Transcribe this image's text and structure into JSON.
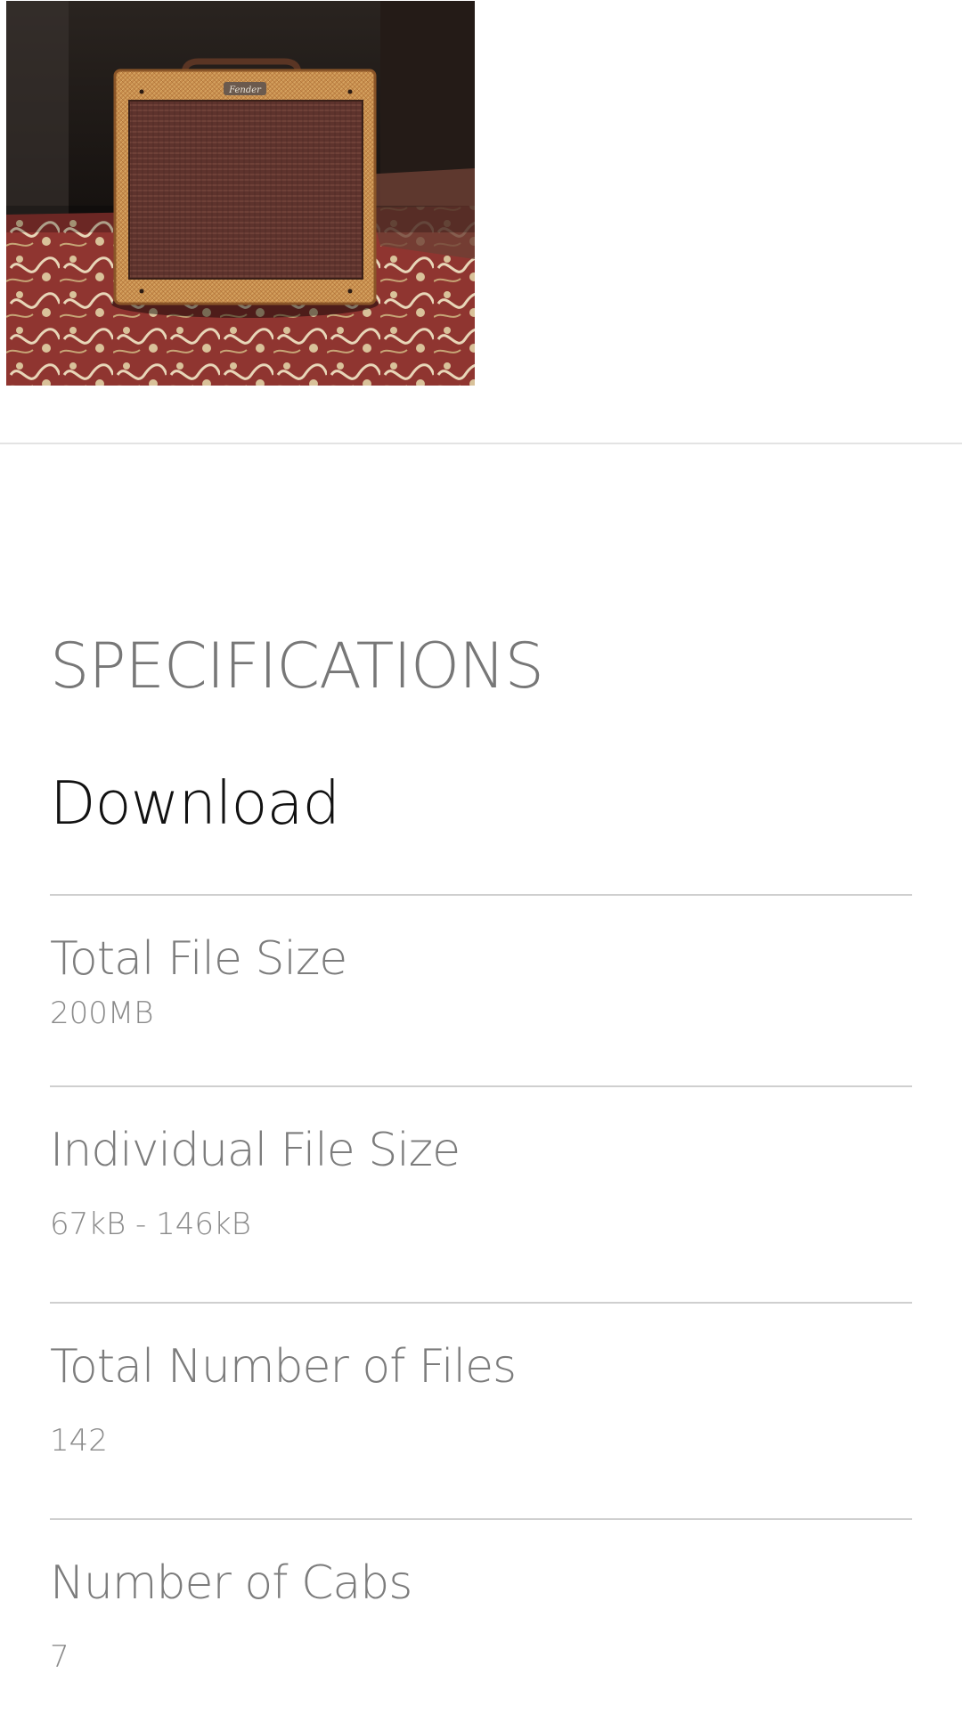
{
  "product_image": {
    "alt": "Tweed guitar amplifier on a patterned rug",
    "badge_text": "Fender",
    "colors": {
      "background": "#1c1613",
      "tweed": "#c98f4e",
      "grille": "#6a3a32",
      "rug": "#9a3b34"
    }
  },
  "specifications": {
    "heading": "SPECIFICATIONS",
    "subheading": "Download",
    "rows": [
      {
        "label": "Total File Size",
        "value": "200MB"
      },
      {
        "label": "Individual File Size",
        "value": "67kB - 146kB"
      },
      {
        "label": "Total Number of Files",
        "value": "142"
      },
      {
        "label": "Number of Cabs",
        "value": "7"
      }
    ]
  }
}
